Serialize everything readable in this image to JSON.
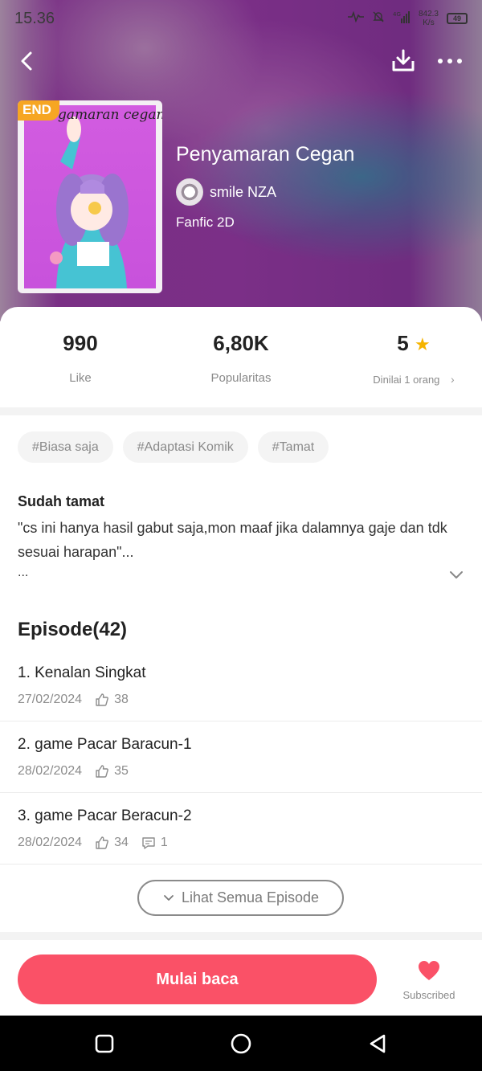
{
  "status_bar": {
    "time": "15.36",
    "net_speed": "842.3",
    "net_unit": "K/s",
    "signal": "4G",
    "battery": "49"
  },
  "book": {
    "cover_title": "gamaran cegan",
    "end_badge": "END",
    "title": "Penyamaran Cegan",
    "author": "smile NZA",
    "genre": "Fanfic 2D"
  },
  "stats": {
    "like_value": "990",
    "like_label": "Like",
    "popularity_value": "6,80K",
    "popularity_label": "Popularitas",
    "rating_value": "5",
    "rating_label": "Dinilai 1 orang"
  },
  "tags": [
    "#Biasa saja",
    "#Adaptasi Komik",
    "#Tamat"
  ],
  "synopsis": {
    "title": "Sudah tamat",
    "body": "\"cs ini hanya hasil gabut saja,mon maaf jika dalamnya gaje dan tdk sesuai harapan\"...",
    "more": "..."
  },
  "episodes_section": {
    "heading": "Episode(42)",
    "see_all_label": "Lihat Semua Episode",
    "items": [
      {
        "title": "1. Kenalan Singkat",
        "date": "27/02/2024",
        "likes": "38",
        "comments": ""
      },
      {
        "title": "2. game Pacar Baracun-1",
        "date": "28/02/2024",
        "likes": "35",
        "comments": ""
      },
      {
        "title": "3. game Pacar Beracun-2",
        "date": "28/02/2024",
        "likes": "34",
        "comments": "1"
      }
    ]
  },
  "bottom": {
    "read_label": "Mulai baca",
    "subscribed_label": "Subscribed"
  },
  "colors": {
    "accent": "#fa5167",
    "badge": "#f6a623",
    "star": "#f5b400",
    "hero": "#9b3da8"
  }
}
